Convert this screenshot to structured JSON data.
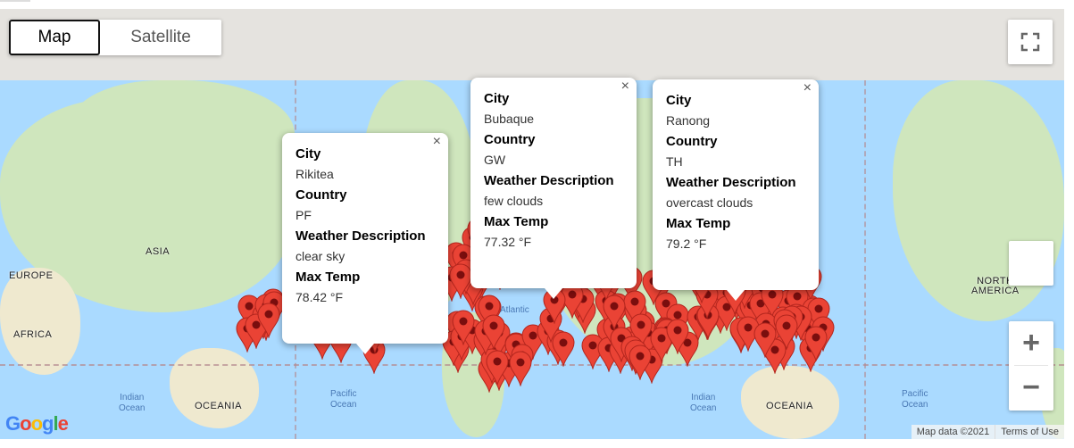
{
  "map_type": {
    "map_label": "Map",
    "satellite_label": "Satellite",
    "selected": "Map"
  },
  "map_labels": {
    "asia": "ASIA",
    "europe": "EUROPE",
    "africa": "AFRICA",
    "oceania_left": "OCEANIA",
    "oceania_right": "OCEANIA",
    "north_america": "NORTH\nAMERICA",
    "atlantic": "Atlantic",
    "indian_ocean_left": "Indian\nOcean",
    "indian_ocean_right": "Indian\nOcean",
    "pacific_ocean_left": "Pacific\nOcean",
    "pacific_ocean_right": "Pacific\nOcean"
  },
  "info_windows": [
    {
      "city_label": "City",
      "city": "Rikitea",
      "country_label": "Country",
      "country": "PF",
      "weather_label": "Weather Description",
      "weather": "clear sky",
      "temp_label": "Max Temp",
      "temp": "78.42 °F"
    },
    {
      "city_label": "City",
      "city": "Bubaque",
      "country_label": "Country",
      "country": "GW",
      "weather_label": "Weather Description",
      "weather": "few clouds",
      "temp_label": "Max Temp",
      "temp": "77.32 °F"
    },
    {
      "city_label": "City",
      "city": "Ranong",
      "country_label": "Country",
      "country": "TH",
      "weather_label": "Weather Description",
      "weather": "overcast clouds",
      "temp_label": "Max Temp",
      "temp": "79.2 °F"
    }
  ],
  "controls": {
    "zoom_in": "+",
    "zoom_out": "−",
    "close": "×",
    "fullscreen_icon": "fullscreen-icon"
  },
  "footer": {
    "map_data": "Map data ©2021",
    "terms": "Terms of Use"
  },
  "logo": "Google",
  "colors": {
    "marker": "#ea4335",
    "water": "#aadaff"
  }
}
